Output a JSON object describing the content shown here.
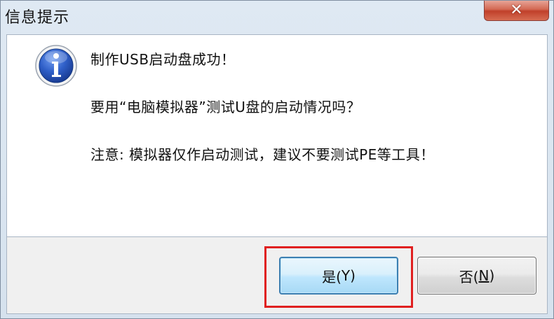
{
  "window": {
    "title": "信息提示",
    "close_label": "✕"
  },
  "icon": "info-icon",
  "message": {
    "line1": "制作USB启动盘成功！",
    "line2": "要用“电脑模拟器”测试U盘的启动情况吗？",
    "line3": "注意: 模拟器仅作启动测试，建议不要测试PE等工具！"
  },
  "buttons": {
    "yes_prefix": "是(",
    "yes_key": "Y",
    "yes_suffix": ")",
    "no_prefix": "否(",
    "no_key": "N",
    "no_suffix": ")"
  },
  "colors": {
    "highlight": "#e02020",
    "icon_blue": "#1f4fb0",
    "focus_border": "#3c7fb1"
  }
}
